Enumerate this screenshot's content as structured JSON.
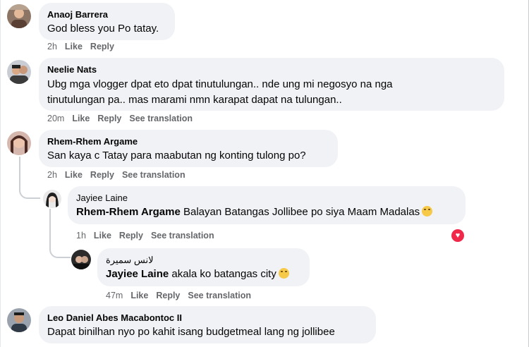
{
  "comments": [
    {
      "name": "Anaoj Barrera",
      "text": "God bless you Po tatay.",
      "time": "2h",
      "like": "Like",
      "reply": "Reply"
    },
    {
      "name": "Neelie Nats",
      "text_line1": "Ubg mga vlogger dpat eto dpat tinutulungan.. nde ung mi negosyo na nga",
      "text_line2": "tinutulungan pa.. mas marami nmn karapat dapat na tulungan..",
      "time": "20m",
      "like": "Like",
      "reply": "Reply",
      "see_translation": "See translation"
    },
    {
      "name": "Rhem-Rhem Argame",
      "text": "San kaya c Tatay para maabutan ng konting tulong po?",
      "time": "2h",
      "like": "Like",
      "reply": "Reply",
      "see_translation": "See translation"
    },
    {
      "name": "Jayiee Laine",
      "tag": "Rhem-Rhem Argame",
      "text": " Balayan Batangas Jollibee po siya Maam Madalas",
      "emoji": "smile-emoji",
      "reaction": "heart",
      "time": "1h",
      "like": "Like",
      "reply": "Reply",
      "see_translation": "See translation"
    },
    {
      "name": "لانس سميرة",
      "tag": "Jayiee Laine",
      "text": " akala ko batangas city",
      "emoji": "sad-emoji",
      "time": "47m",
      "like": "Like",
      "reply": "Reply",
      "see_translation": "See translation"
    },
    {
      "name": "Leo Daniel Abes Macabontoc II",
      "text": "Dapat binilhan nyo po kahit isang budgetmeal lang ng jollibee"
    }
  ],
  "colors": {
    "bubble": "#f0f2f5",
    "meta": "#65676b",
    "heart": "#f0284a"
  }
}
